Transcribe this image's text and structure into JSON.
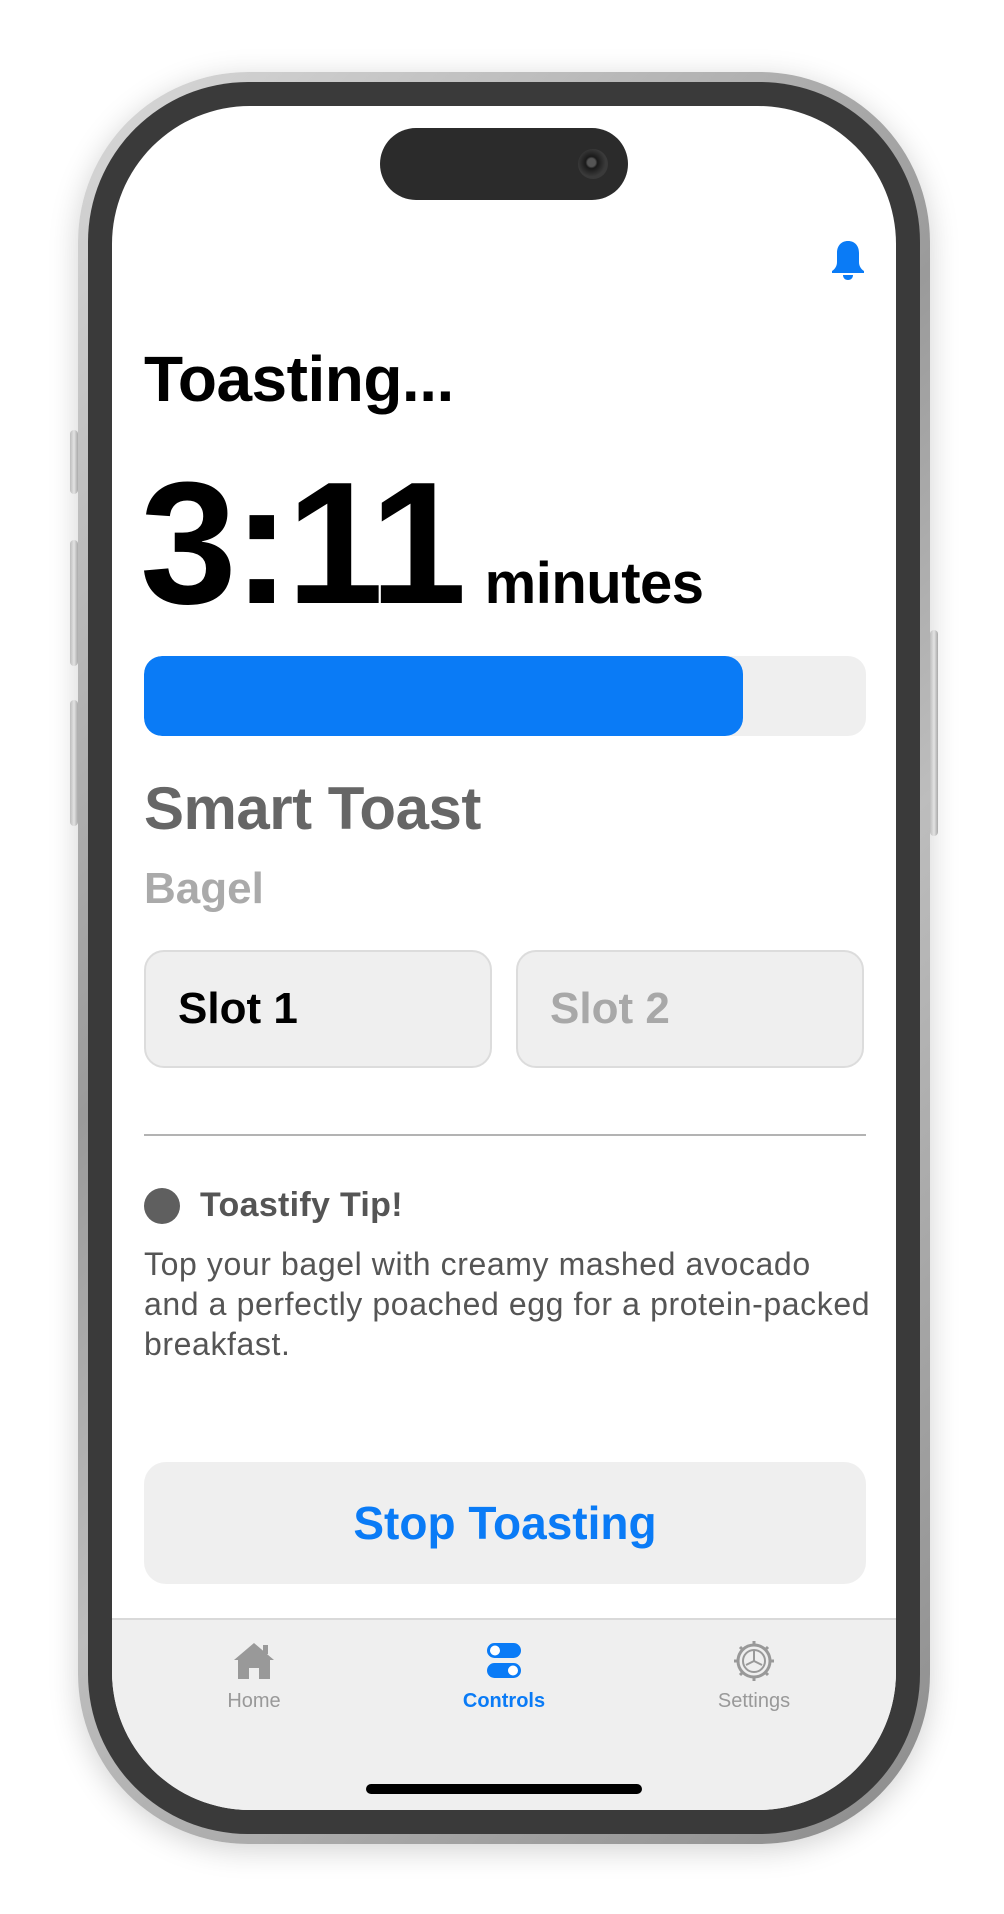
{
  "header": {
    "status_title": "Toasting..."
  },
  "timer": {
    "value": "3:11",
    "unit": "minutes",
    "progress_percent": 83
  },
  "program": {
    "name": "Smart Toast",
    "bread_type": "Bagel"
  },
  "slots": [
    {
      "label": "Slot 1",
      "active": true
    },
    {
      "label": "Slot 2",
      "active": false
    }
  ],
  "tip": {
    "title": "Toastify Tip!",
    "body": "Top your bagel with creamy mashed avocado and a perfectly poached egg for a protein-packed breakfast."
  },
  "actions": {
    "stop_label": "Stop Toasting"
  },
  "tab_bar": {
    "tabs": [
      {
        "label": "Home",
        "icon": "house-icon",
        "selected": false
      },
      {
        "label": "Controls",
        "icon": "toggles-icon",
        "selected": true
      },
      {
        "label": "Settings",
        "icon": "gear-icon",
        "selected": false
      }
    ]
  },
  "icons": {
    "top_right": "bell-icon"
  },
  "colors": {
    "accent": "#0a7bf6",
    "secondary_text": "#666666",
    "tertiary_text": "#aaaaaa",
    "fill_background": "#efefef"
  }
}
